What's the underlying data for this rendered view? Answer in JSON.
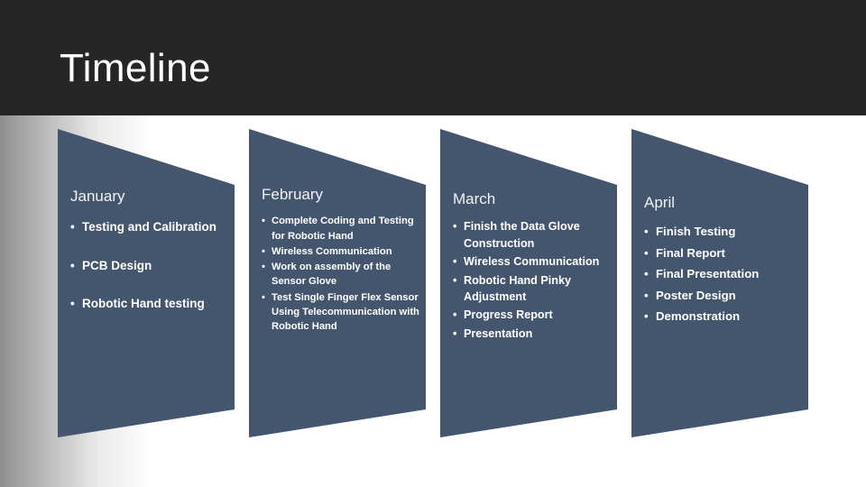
{
  "slide": {
    "title": "Timeline",
    "header_bg": "#262626",
    "shape_fill": "#44556e",
    "text_color": "#ffffff"
  },
  "timeline": {
    "columns": [
      {
        "month": "January",
        "items": [
          "Testing and Calibration",
          "PCB Design",
          "Robotic Hand testing"
        ]
      },
      {
        "month": "February",
        "items": [
          "Complete Coding and Testing for Robotic Hand",
          "Wireless Communication",
          "Work on assembly of the Sensor Glove",
          "Test Single Finger Flex Sensor Using Telecommunication with Robotic Hand"
        ]
      },
      {
        "month": "March",
        "items": [
          "Finish the Data Glove Construction",
          "Wireless Communication",
          "Robotic Hand Pinky Adjustment",
          "Progress Report",
          " Presentation"
        ]
      },
      {
        "month": "April",
        "items": [
          "Finish Testing",
          "Final Report",
          "Final Presentation",
          "Poster Design",
          "Demonstration"
        ]
      }
    ]
  }
}
